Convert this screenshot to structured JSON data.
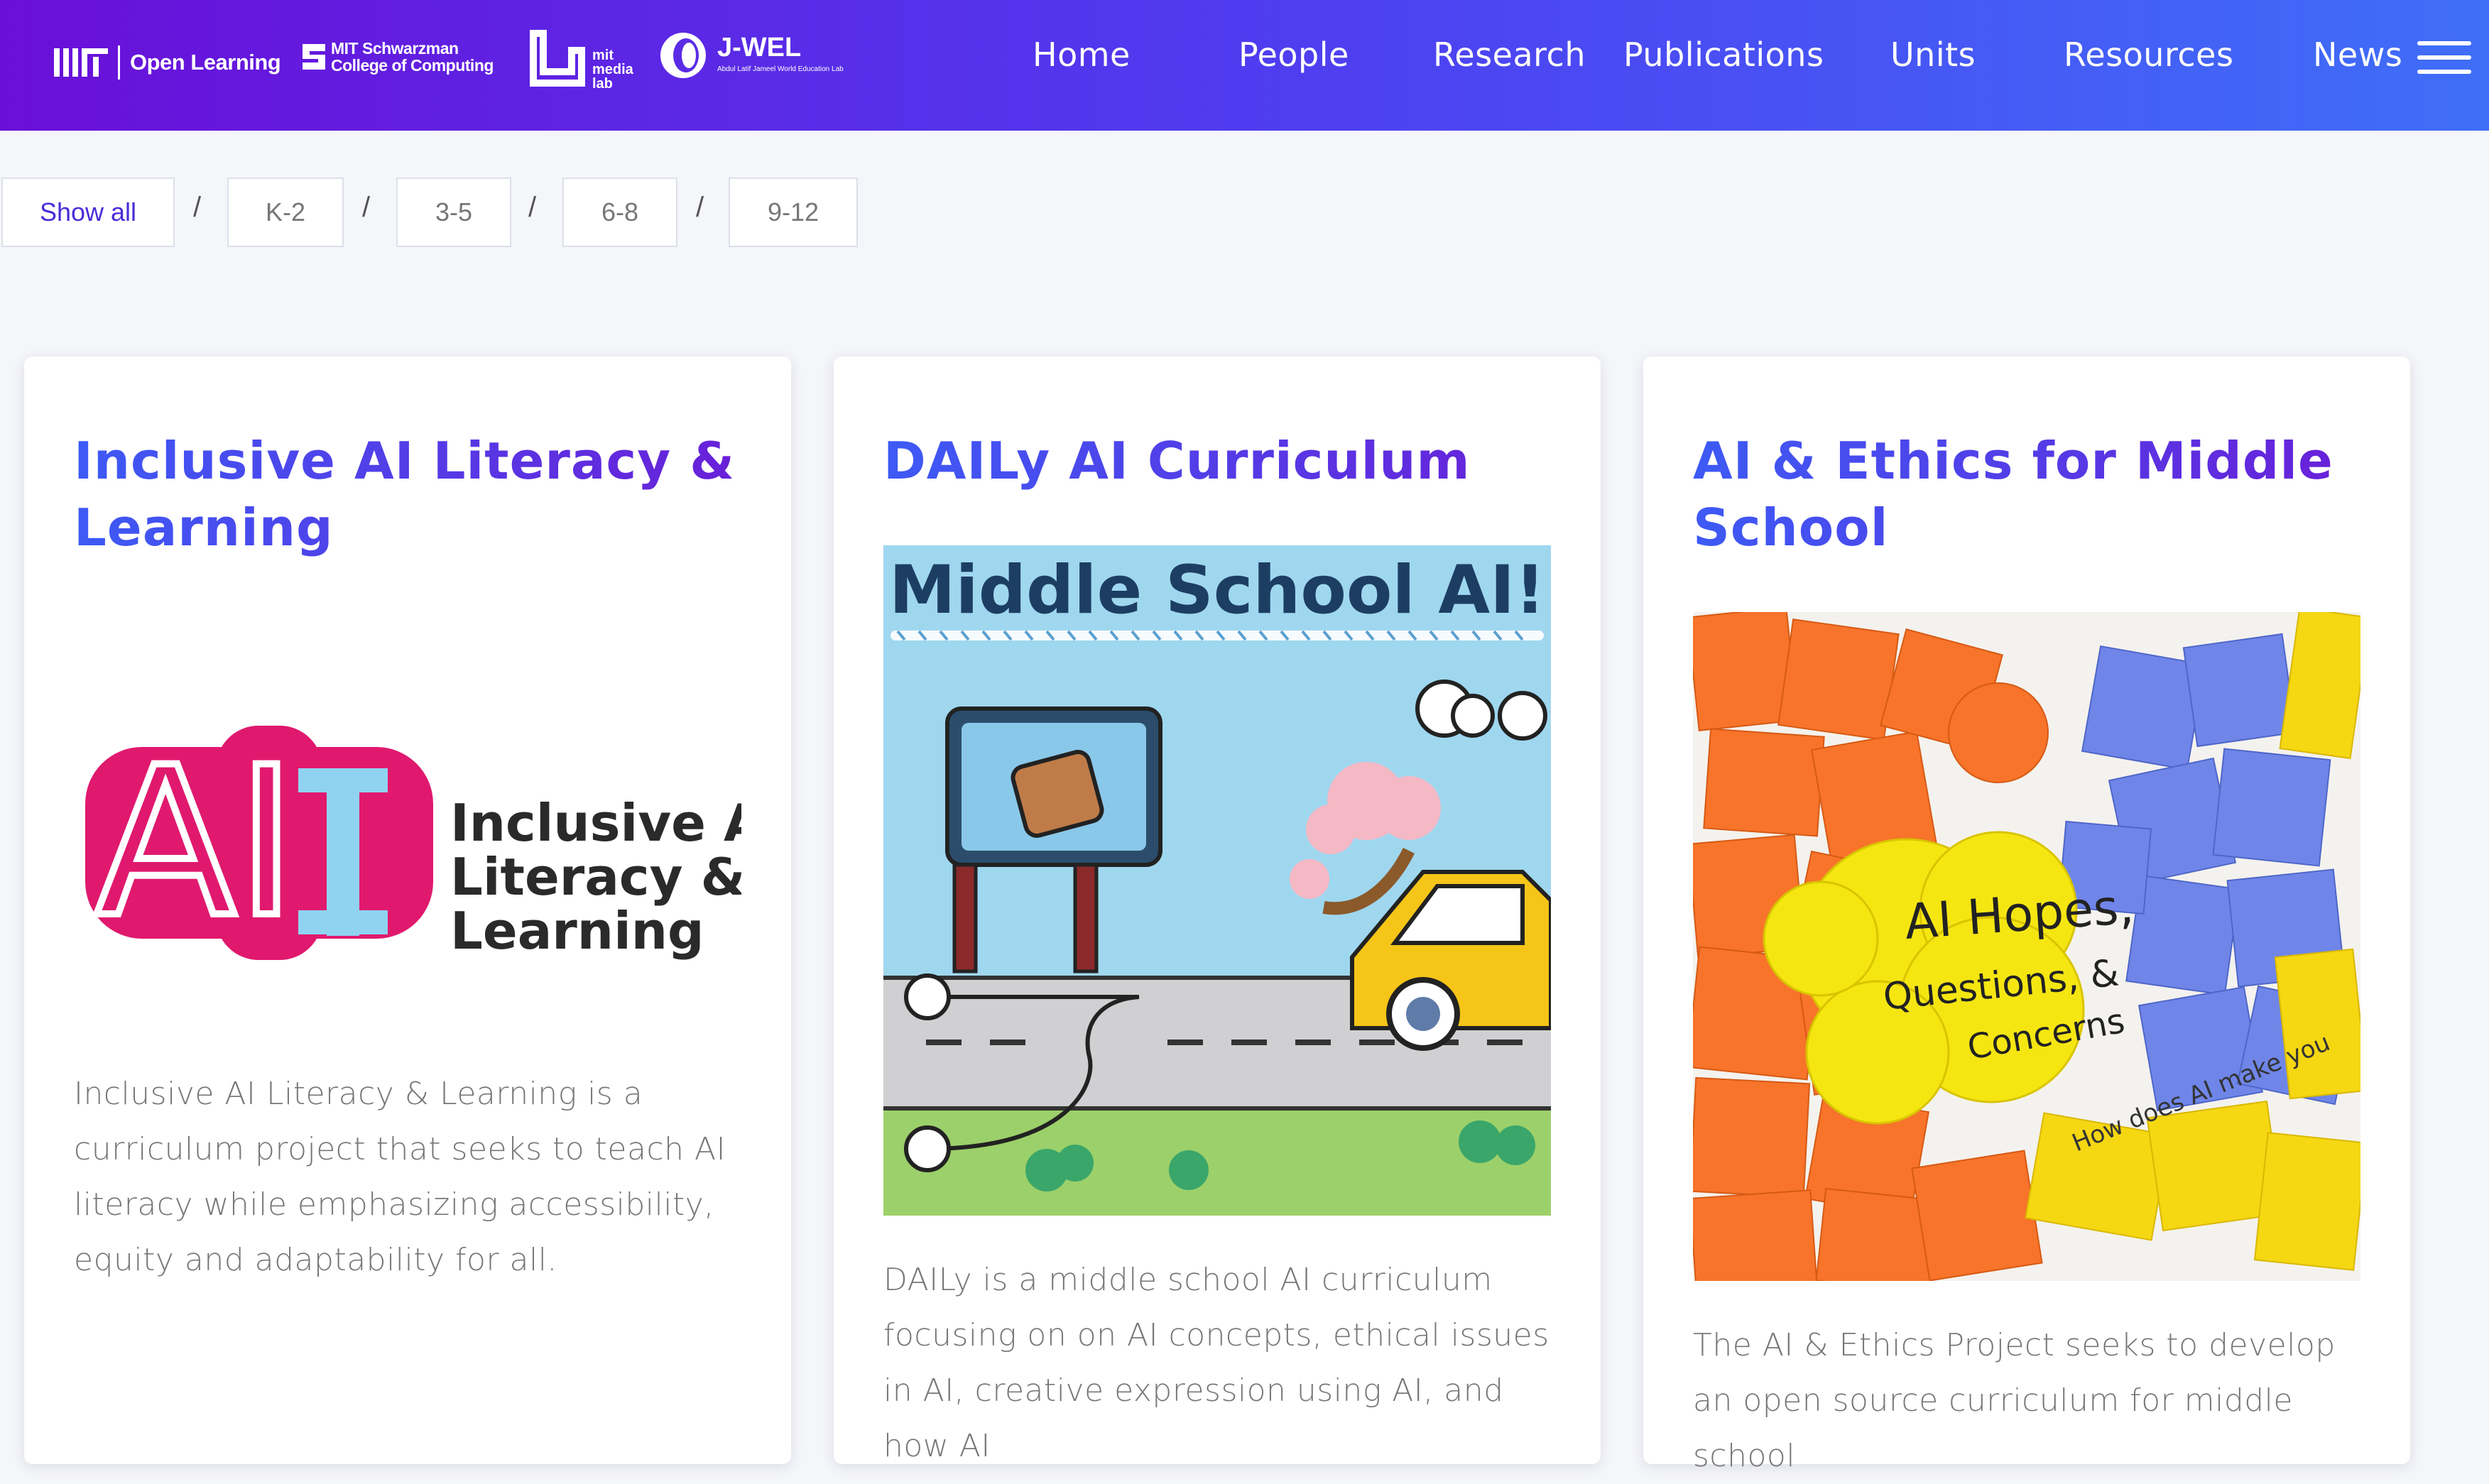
{
  "header": {
    "logos": {
      "open_learning": "Open Learning",
      "schwarzman_line1": "MIT Schwarzman",
      "schwarzman_line2": "College of Computing",
      "media_lab_line1": "mit",
      "media_lab_line2": "media",
      "media_lab_line3": "lab",
      "jwel_title": "J-WEL",
      "jwel_subtitle": "Abdul Latif Jameel World Education Lab"
    },
    "nav": [
      "Home",
      "People",
      "Research",
      "Publications",
      "Units",
      "Resources",
      "News"
    ]
  },
  "filters": {
    "items": [
      "Show all",
      "K-2",
      "3-5",
      "6-8",
      "9-12"
    ],
    "active": "Show all",
    "separator": "/"
  },
  "cards": [
    {
      "title": "Inclusive AI Literacy & Learning",
      "image": {
        "logo_letters": "AI",
        "logo_line1": "Inclusive AI",
        "logo_line2": "Literacy &",
        "logo_line3": "Learning"
      },
      "description": "Inclusive AI Literacy & Learning is a curriculum project that seeks to teach AI literacy while emphasizing accessibility, equity and adaptability for all."
    },
    {
      "title": "DAILy AI Curriculum",
      "image": {
        "banner": "Middle School AI!"
      },
      "description": "DAILy is a middle school AI curriculum focusing on on AI concepts, ethical issues in AI, creative expression using AI, and how AI"
    },
    {
      "title": "AI & Ethics for Middle School",
      "image": {
        "line1": "AI Hopes,",
        "line2": "Questions, &",
        "line3": "Concerns",
        "side_note": "How does AI make you"
      },
      "description": "The AI & Ethics Project seeks to develop an open source curriculum for middle school"
    }
  ],
  "colors": {
    "header_start": "#6a0fd8",
    "header_end": "#3f6ef8",
    "title_accent": "#4b2bd8",
    "ai_pink": "#e0196e",
    "ai_blue": "#8fd3f0"
  }
}
